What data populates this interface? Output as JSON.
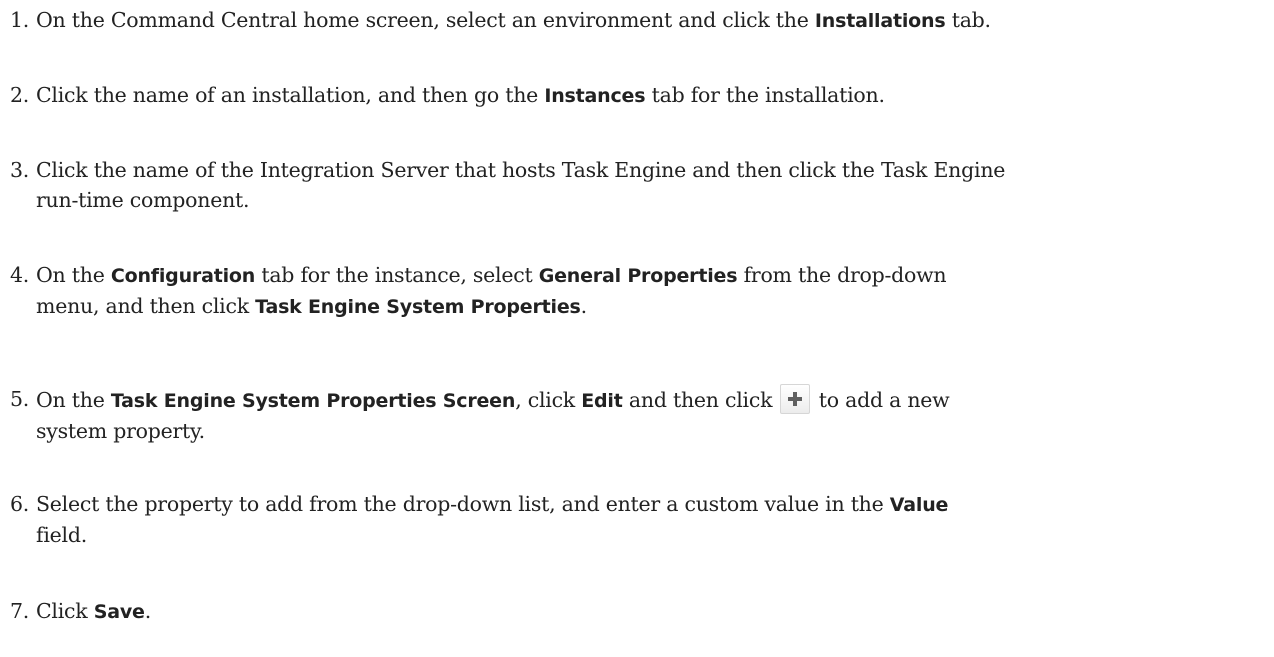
{
  "steps": [
    {
      "number": "1.",
      "parts": [
        "On the Command Central home screen, select an environment and click the ",
        "Installations",
        " tab."
      ]
    },
    {
      "number": "2.",
      "parts": [
        "Click the name of an installation, and then go the ",
        "Instances",
        " tab for the installation."
      ]
    },
    {
      "number": "3.",
      "text_line1": "Click the name of the Integration Server that hosts Task Engine and then click the Task Engine",
      "text_line2": "run-time component."
    },
    {
      "number": "4.",
      "parts": [
        "On the ",
        "Configuration",
        " tab for the instance, select ",
        "General Properties",
        " from the drop-down",
        "menu, and then click ",
        "Task Engine System Properties",
        "."
      ]
    },
    {
      "number": "5.",
      "parts": [
        "On the ",
        "Task Engine System Properties Screen",
        ", click ",
        "Edit",
        " and then click ",
        " to add a new",
        "system property."
      ],
      "icon": "plus-icon"
    },
    {
      "number": "6.",
      "parts": [
        "Select the property to add from the drop-down list, and enter a custom value in the ",
        "Value",
        "field."
      ]
    },
    {
      "number": "7.",
      "parts": [
        "Click ",
        "Save",
        "."
      ]
    }
  ]
}
